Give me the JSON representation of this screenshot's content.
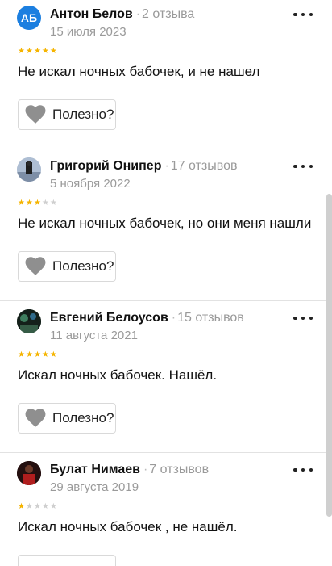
{
  "useful_label": "Полезно?",
  "colors": {
    "star_on": "#f5b400",
    "star_off": "#cfcfcf",
    "heart": "#8f8f8f"
  },
  "reviews": [
    {
      "name": "Антон Белов",
      "count": "2 отзыва",
      "date": "15 июля 2023",
      "rating": 5,
      "text": "Не искал ночных бабочек, и не нашел",
      "avatar": {
        "type": "initials",
        "text": "АБ"
      }
    },
    {
      "name": "Григорий Онипер",
      "count": "17 отзывов",
      "date": "5 ноября 2022",
      "rating": 3,
      "text": "Не искал ночных бабочек, но они меня нашли",
      "avatar": {
        "type": "photo"
      }
    },
    {
      "name": "Евгений Белоусов",
      "count": "15 отзывов",
      "date": "11 августа 2021",
      "rating": 5,
      "text": "Искал ночных бабочек. Нашёл.",
      "avatar": {
        "type": "photo"
      }
    },
    {
      "name": "Булат Нимаев",
      "count": "7 отзывов",
      "date": "29 августа 2019",
      "rating": 1,
      "text": "Искал ночных бабочек , не нашёл.",
      "avatar": {
        "type": "photo"
      }
    }
  ]
}
